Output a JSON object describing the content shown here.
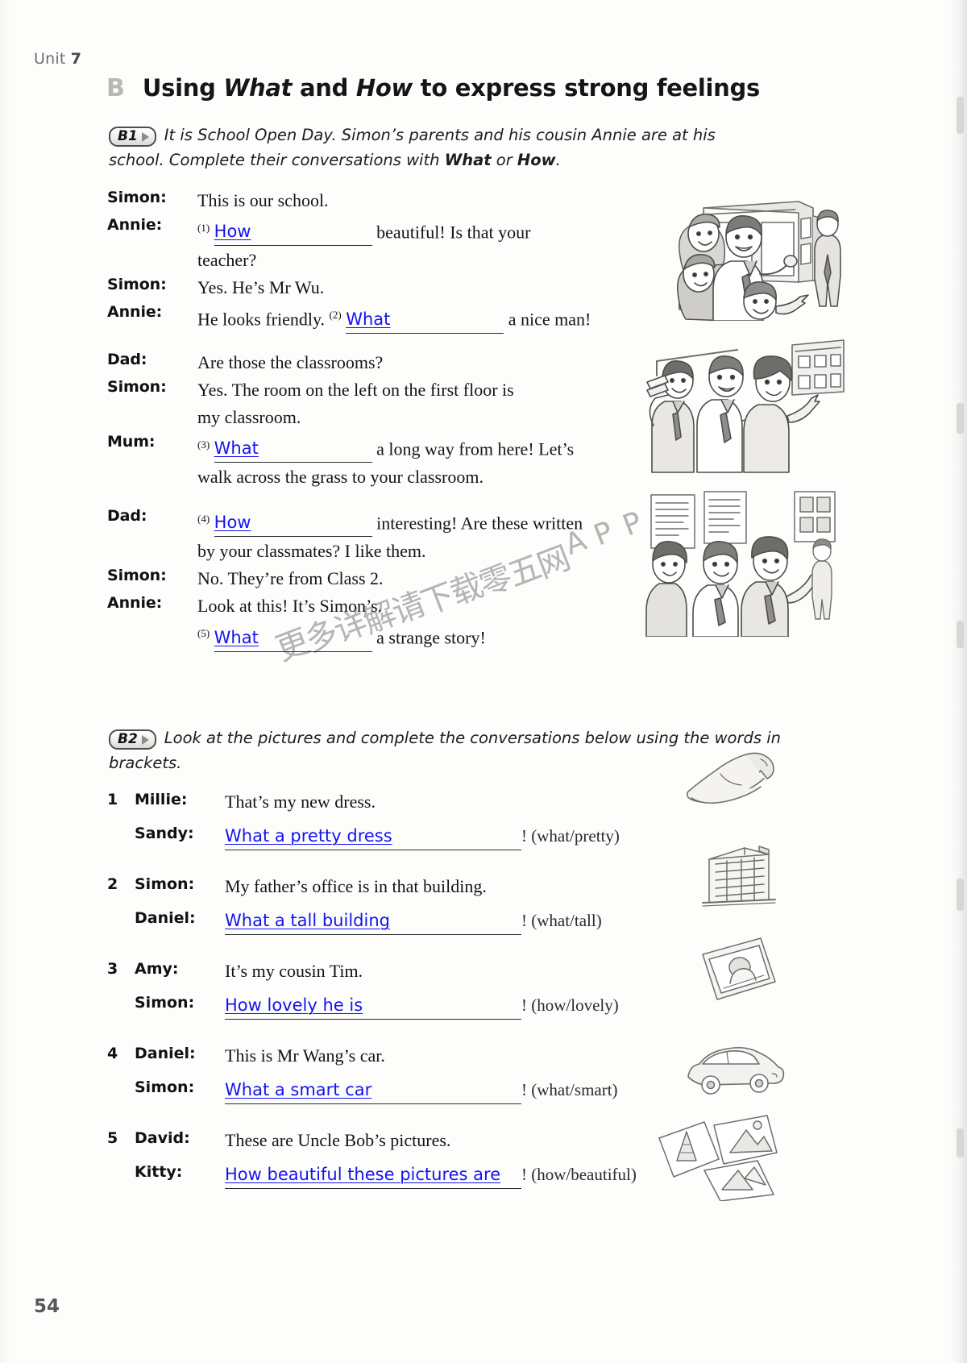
{
  "running_head": {
    "label": "Unit",
    "number": "7"
  },
  "section": {
    "letter": "B",
    "title_prefix": "Using ",
    "title_word1": "What",
    "title_mid": " and ",
    "title_word2": "How",
    "title_suffix": " to express strong feelings"
  },
  "b1": {
    "badge": "B1",
    "instruction": "It is School Open Day. Simon’s parents and his cousin Annie are at his school. Complete their conversations with ",
    "instruction_bold1": "What",
    "instruction_mid": " or ",
    "instruction_bold2": "How",
    "instruction_end": ".",
    "groups": [
      {
        "rows": [
          {
            "speaker": "Simon:",
            "before": "This is our school.",
            "num": "",
            "answer": "",
            "after": "",
            "cont": ""
          },
          {
            "speaker": "Annie:",
            "before": "",
            "num": "(1)",
            "answer": "How",
            "after": " beautiful! Is that your",
            "cont": "teacher?"
          },
          {
            "speaker": "Simon:",
            "before": "Yes. He’s Mr Wu.",
            "num": "",
            "answer": "",
            "after": "",
            "cont": ""
          },
          {
            "speaker": "Annie:",
            "before": "He looks friendly. ",
            "num": "(2)",
            "answer": "What",
            "after": " a nice man!",
            "cont": ""
          }
        ]
      },
      {
        "rows": [
          {
            "speaker": "Dad:",
            "before": "Are those the classrooms?",
            "num": "",
            "answer": "",
            "after": "",
            "cont": ""
          },
          {
            "speaker": "Simon:",
            "before": "Yes. The room on the left on the first floor is",
            "num": "",
            "answer": "",
            "after": "",
            "cont": "my classroom."
          },
          {
            "speaker": "Mum:",
            "before": "",
            "num": "(3)",
            "answer": "What",
            "after": " a long way from here! Let’s",
            "cont": "walk across the grass to your classroom."
          }
        ]
      },
      {
        "rows": [
          {
            "speaker": "Dad:",
            "before": "",
            "num": "(4)",
            "answer": "How",
            "after": " interesting! Are these written",
            "cont": "by your classmates? I like them."
          },
          {
            "speaker": "Simon:",
            "before": "No. They’re from Class 2.",
            "num": "",
            "answer": "",
            "after": "",
            "cont": ""
          },
          {
            "speaker": "Annie:",
            "before": "Look at this! It’s Simon’s.",
            "num": "",
            "answer": "",
            "after": "",
            "cont": ""
          },
          {
            "speaker": "",
            "before": "",
            "num": "(5)",
            "answer": "What",
            "after": " a strange story!",
            "cont": ""
          }
        ]
      }
    ]
  },
  "b2": {
    "badge": "B2",
    "instruction": "Look at the pictures and complete the conversations below using the words in brackets.",
    "items": [
      {
        "number": "1",
        "prompt_speaker": "Millie:",
        "prompt_text": "That’s my new dress.",
        "answer_speaker": "Sandy:",
        "answer": "What a pretty dress",
        "hint": "! (what/pretty)",
        "picture": "dress-sketch"
      },
      {
        "number": "2",
        "prompt_speaker": "Simon:",
        "prompt_text": "My father’s office is in that building.",
        "answer_speaker": "Daniel:",
        "answer": "What a tall building",
        "hint": "! (what/tall)",
        "picture": "building-sketch"
      },
      {
        "number": "3",
        "prompt_speaker": "Amy:",
        "prompt_text": "It’s my cousin Tim.",
        "answer_speaker": "Simon:",
        "answer": "How lovely he is",
        "hint": "! (how/lovely)",
        "picture": "photo-sketch"
      },
      {
        "number": "4",
        "prompt_speaker": "Daniel:",
        "prompt_text": "This is Mr Wang’s car.",
        "answer_speaker": "Simon:",
        "answer": "What a smart car",
        "hint": "! (what/smart)",
        "picture": "car-sketch"
      },
      {
        "number": "5",
        "prompt_speaker": "David:",
        "prompt_text": "These are Uncle Bob’s pictures.",
        "answer_speaker": "Kitty:",
        "answer": "How beautiful these pictures are ",
        "hint": "! (how/beautiful)",
        "picture": "pictures-sketch"
      }
    ]
  },
  "illustrations": [
    {
      "name": "students-outside-school-building"
    },
    {
      "name": "family-pointing-at-classrooms"
    },
    {
      "name": "students-looking-at-wall-displays"
    }
  ],
  "watermark": {
    "chars": [
      "更",
      "多",
      "详",
      "解",
      "请",
      "下",
      "载",
      "零",
      "五",
      "网",
      "A",
      "P",
      "P"
    ],
    "text": "更多详解请下载零五网APP"
  },
  "folio": "54"
}
